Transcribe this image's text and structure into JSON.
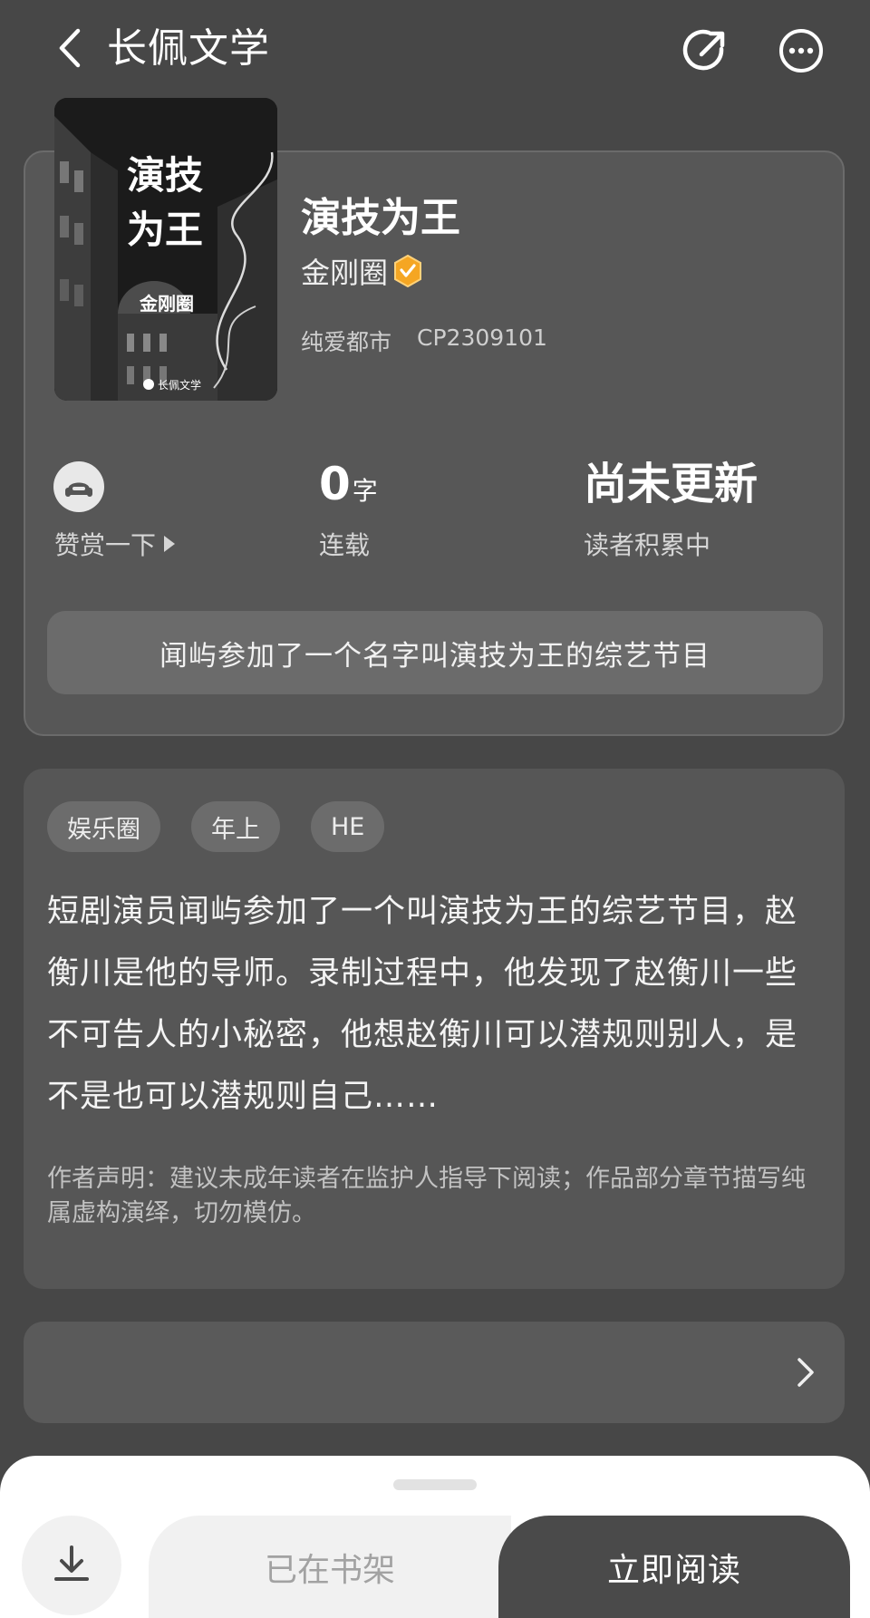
{
  "header": {
    "back_icon": "chevron-left-icon",
    "app_title": "长佩文学",
    "share_icon": "share-icon",
    "more_icon": "more-icon"
  },
  "book": {
    "cover": {
      "title_line1": "演技",
      "title_line2": "为王",
      "author": "金刚圈",
      "publisher_mark": "长佩文学"
    },
    "title": "演技为王",
    "author": "金刚圈",
    "verified_icon": "verified-badge-icon",
    "category": "纯爱都市",
    "id": "CP2309101",
    "reward": {
      "icon": "reward-icon",
      "label": "赞赏一下"
    },
    "word_count": {
      "value": "0",
      "unit": "字",
      "label": "连载"
    },
    "update": {
      "value": "尚未更新",
      "label": "读者积累中"
    },
    "tagline": "闻屿参加了一个名字叫演技为王的综艺节目"
  },
  "intro": {
    "tags": [
      "娱乐圈",
      "年上",
      "HE"
    ],
    "synopsis": "短剧演员闻屿参加了一个叫演技为王的综艺节目，赵衡川是他的导师。录制过程中，他发现了赵衡川一些不可告人的小秘密，他想赵衡川可以潜规则别人，是不是也可以潜规则自己……",
    "disclaimer": "作者声明：建议未成年读者在监护人指导下阅读；作品部分章节描写纯属虚构演绎，切勿模仿。"
  },
  "bottom_bar": {
    "download_icon": "download-icon",
    "shelf_label": "已在书架",
    "read_label": "立即阅读"
  },
  "colors": {
    "background": "#474747",
    "card": "#575757",
    "badge": "#f5a623",
    "sheet": "#ffffff",
    "primary_button": "#4a4a4a"
  }
}
